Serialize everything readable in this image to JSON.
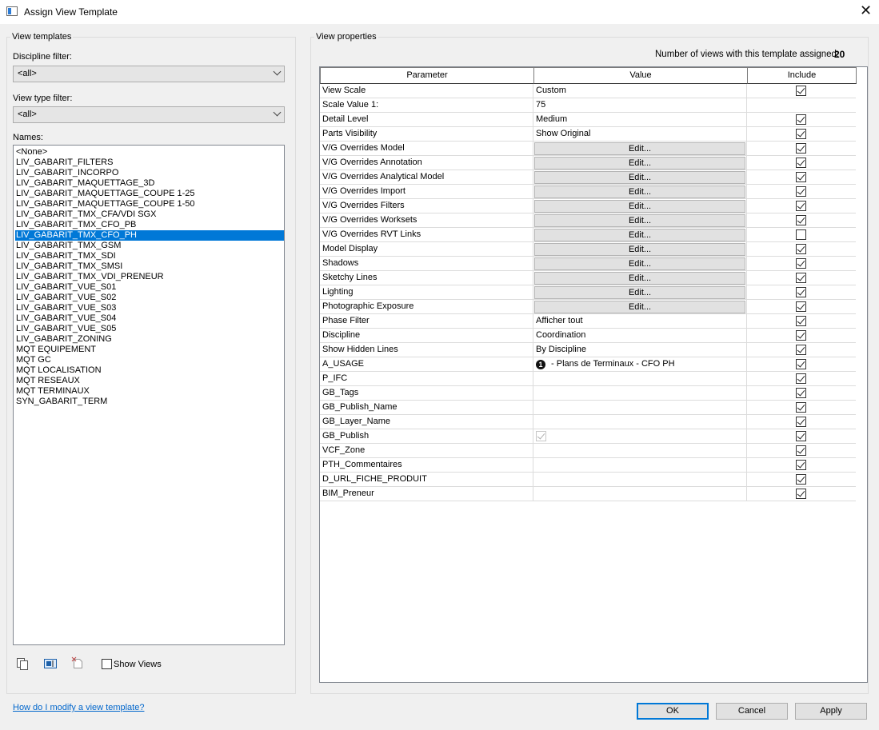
{
  "window": {
    "title": "Assign View Template",
    "close_glyph": "✕"
  },
  "left": {
    "group_title": "View templates",
    "discipline": {
      "label": "Discipline filter:",
      "value": "<all>"
    },
    "view_type": {
      "label": "View type filter:",
      "value": "<all>"
    },
    "names_label": "Names:",
    "names": [
      "<None>",
      "LIV_GABARIT_FILTERS",
      "LIV_GABARIT_INCORPO",
      "LIV_GABARIT_MAQUETTAGE_3D",
      "LIV_GABARIT_MAQUETTAGE_COUPE 1-25",
      "LIV_GABARIT_MAQUETTAGE_COUPE 1-50",
      "LIV_GABARIT_TMX_CFA/VDI SGX",
      "LIV_GABARIT_TMX_CFO_PB",
      "LIV_GABARIT_TMX_CFO_PH",
      "LIV_GABARIT_TMX_GSM",
      "LIV_GABARIT_TMX_SDI",
      "LIV_GABARIT_TMX_SMSI",
      "LIV_GABARIT_TMX_VDI_PRENEUR",
      "LIV_GABARIT_VUE_S01",
      "LIV_GABARIT_VUE_S02",
      "LIV_GABARIT_VUE_S03",
      "LIV_GABARIT_VUE_S04",
      "LIV_GABARIT_VUE_S05",
      "LIV_GABARIT_ZONING",
      "MQT EQUIPEMENT",
      "MQT GC",
      "MQT LOCALISATION",
      "MQT RESEAUX",
      "MQT TERMINAUX",
      "SYN_GABARIT_TERM"
    ],
    "selected_index": 8,
    "show_views_label": "Show Views",
    "toolbar_icons": [
      "duplicate-icon",
      "rename-icon",
      "delete-icon"
    ]
  },
  "right": {
    "group_title": "View properties",
    "assigned_label": "Number of views with this template assigned:",
    "assigned_count": "20",
    "columns": [
      "Parameter",
      "Value",
      "Include"
    ],
    "rows": [
      {
        "param": "View Scale",
        "value": "Custom",
        "type": "text",
        "include": true
      },
      {
        "param": "Scale Value    1:",
        "value": "75",
        "type": "text",
        "include": null
      },
      {
        "param": "Detail Level",
        "value": "Medium",
        "type": "text",
        "include": true
      },
      {
        "param": "Parts Visibility",
        "value": "Show Original",
        "type": "text",
        "include": true
      },
      {
        "param": "V/G Overrides Model",
        "value": "Edit...",
        "type": "button",
        "include": true
      },
      {
        "param": "V/G Overrides Annotation",
        "value": "Edit...",
        "type": "button",
        "include": true
      },
      {
        "param": "V/G Overrides Analytical Model",
        "value": "Edit...",
        "type": "button",
        "include": true
      },
      {
        "param": "V/G Overrides Import",
        "value": "Edit...",
        "type": "button",
        "include": true
      },
      {
        "param": "V/G Overrides Filters",
        "value": "Edit...",
        "type": "button",
        "include": true
      },
      {
        "param": "V/G Overrides Worksets",
        "value": "Edit...",
        "type": "button",
        "include": true
      },
      {
        "param": "V/G Overrides RVT Links",
        "value": "Edit...",
        "type": "button",
        "include": false
      },
      {
        "param": "Model Display",
        "value": "Edit...",
        "type": "button",
        "include": true
      },
      {
        "param": "Shadows",
        "value": "Edit...",
        "type": "button",
        "include": true
      },
      {
        "param": "Sketchy Lines",
        "value": "Edit...",
        "type": "button",
        "include": true
      },
      {
        "param": "Lighting",
        "value": "Edit...",
        "type": "button",
        "include": true
      },
      {
        "param": "Photographic Exposure",
        "value": "Edit...",
        "type": "button",
        "include": true
      },
      {
        "param": "Phase Filter",
        "value": "Afficher tout",
        "type": "text",
        "include": true
      },
      {
        "param": "Discipline",
        "value": "Coordination",
        "type": "text",
        "include": true
      },
      {
        "param": "Show Hidden Lines",
        "value": "By Discipline",
        "type": "text",
        "include": true
      },
      {
        "param": "A_USAGE",
        "value": " - Plans de Terminaux - CFO PH",
        "badge": "1",
        "type": "text",
        "include": true
      },
      {
        "param": "P_IFC",
        "value": "",
        "type": "text",
        "include": true
      },
      {
        "param": "GB_Tags",
        "value": "",
        "type": "text",
        "include": true
      },
      {
        "param": "GB_Publish_Name",
        "value": "",
        "type": "text",
        "include": true
      },
      {
        "param": "GB_Layer_Name",
        "value": "",
        "type": "text",
        "include": true
      },
      {
        "param": "GB_Publish",
        "value": "",
        "type": "readonly-check",
        "include": true
      },
      {
        "param": "VCF_Zone",
        "value": "",
        "type": "text",
        "include": true
      },
      {
        "param": "PTH_Commentaires",
        "value": "",
        "type": "text",
        "include": true
      },
      {
        "param": "D_URL_FICHE_PRODUIT",
        "value": "",
        "type": "text",
        "include": true
      },
      {
        "param": "BIM_Preneur",
        "value": "",
        "type": "text",
        "include": true
      }
    ]
  },
  "footer": {
    "help_link": "How do I modify a view template?",
    "ok": "OK",
    "cancel": "Cancel",
    "apply": "Apply"
  }
}
